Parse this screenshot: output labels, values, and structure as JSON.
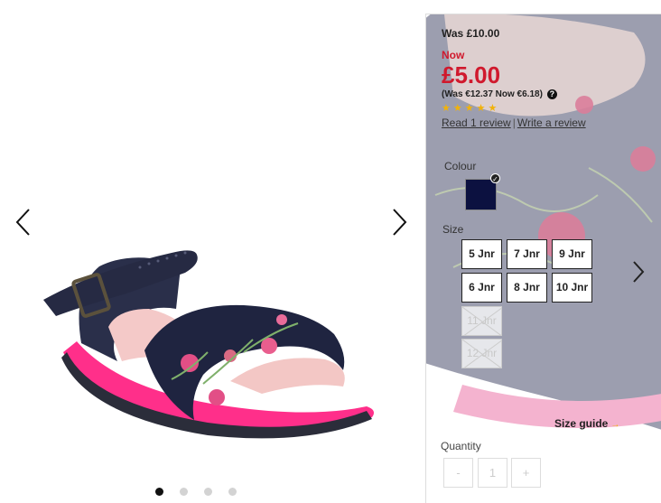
{
  "gallery": {
    "prev_icon": "chevron-left-icon",
    "next_icon": "chevron-right-icon",
    "dots": [
      true,
      false,
      false,
      false
    ]
  },
  "pricing": {
    "was": "Was £10.00",
    "now_label": "Now",
    "price": "£5.00",
    "euro": "(Was €12.37 Now €6.18)",
    "help_glyph": "?",
    "accent": "#d0192d"
  },
  "rating": {
    "stars": 5,
    "star_glyph": "★"
  },
  "reviews": {
    "read": "Read 1 review",
    "separator": "|",
    "write": "Write a review"
  },
  "colour": {
    "label": "Colour",
    "selected": "#0c1140",
    "check": "✓"
  },
  "size": {
    "label": "Size",
    "options": [
      {
        "label": "5 Jnr",
        "available": true
      },
      {
        "label": "7 Jnr",
        "available": true
      },
      {
        "label": "9 Jnr",
        "available": true
      },
      {
        "label": "6 Jnr",
        "available": true
      },
      {
        "label": "8 Jnr",
        "available": true
      },
      {
        "label": "10 Jnr",
        "available": true
      },
      {
        "label": "11 Jnr",
        "available": false
      },
      {
        "label": "12 Jnr",
        "available": false
      }
    ]
  },
  "size_guide": {
    "label": "Size guide",
    "arrow": "→"
  },
  "quantity": {
    "label": "Quantity",
    "minus": "-",
    "value": "1",
    "plus": "+"
  }
}
